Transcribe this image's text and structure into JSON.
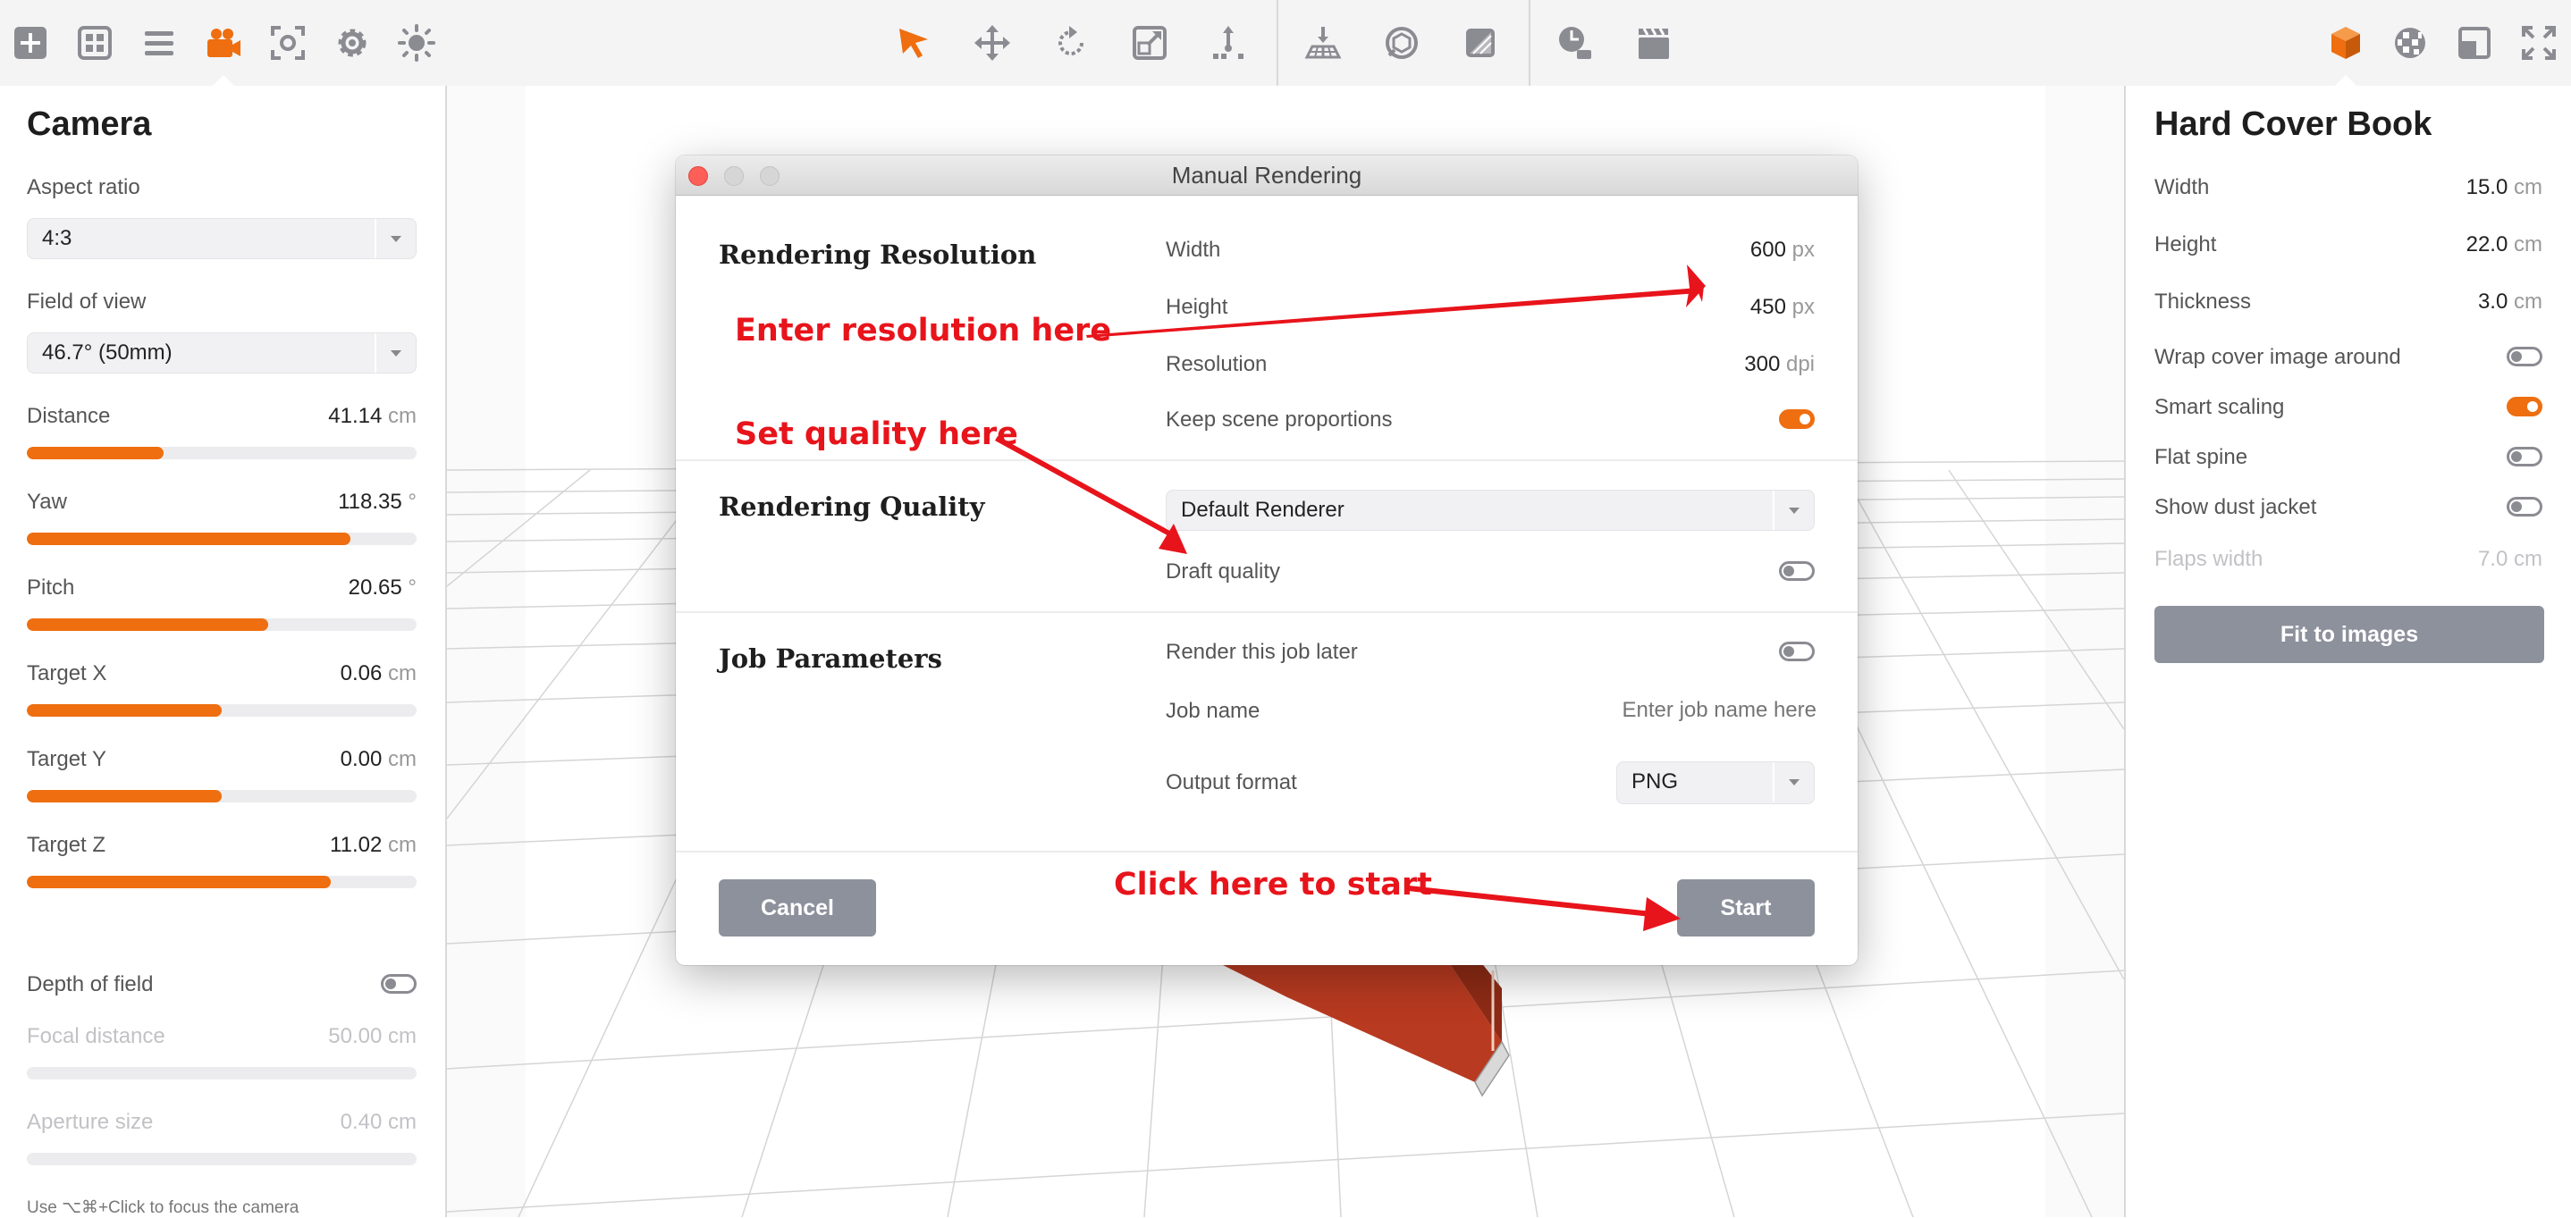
{
  "toolbar": {
    "left_icons": [
      "add-icon",
      "grid-icon",
      "list-icon",
      "camera-icon",
      "focus-icon",
      "gear-icon",
      "light-icon"
    ],
    "center_icons": [
      "select-arrow-icon",
      "move-icon",
      "rotate-icon",
      "scale-icon",
      "transform-icon"
    ],
    "scene_icons": [
      "ground-icon",
      "environment-icon",
      "material-icon"
    ],
    "render_icons": [
      "render-queue-icon",
      "clapper-icon"
    ],
    "right_icons": [
      "object-cube-icon",
      "texture-ball-icon",
      "layout-icon",
      "fullscreen-icon"
    ],
    "accent": "#ee6e10",
    "icon_color": "#8b8b92"
  },
  "camera": {
    "title": "Camera",
    "aspect_ratio_label": "Aspect ratio",
    "aspect_ratio_value": "4:3",
    "fov_label": "Field of view",
    "fov_value": "46.7° (50mm)",
    "sliders": [
      {
        "label": "Distance",
        "value": "41.14",
        "unit": "cm",
        "fraction": 0.35
      },
      {
        "label": "Yaw",
        "value": "118.35",
        "unit": "°",
        "fraction": 0.83
      },
      {
        "label": "Pitch",
        "value": "20.65",
        "unit": "°",
        "fraction": 0.62
      },
      {
        "label": "Target X",
        "value": "0.06",
        "unit": "cm",
        "fraction": 0.5
      },
      {
        "label": "Target Y",
        "value": "0.00",
        "unit": "cm",
        "fraction": 0.5
      },
      {
        "label": "Target Z",
        "value": "11.02",
        "unit": "cm",
        "fraction": 0.78
      }
    ],
    "dof_label": "Depth of field",
    "dof_on": false,
    "focal_label": "Focal distance",
    "focal_value": "50.00",
    "focal_unit": "cm",
    "aperture_label": "Aperture size",
    "aperture_value": "0.40",
    "aperture_unit": "cm",
    "hint": "Use ⌥⌘+Click to focus the camera"
  },
  "book": {
    "title": "Hard Cover Book",
    "width_label": "Width",
    "width_value": "15.0",
    "width_unit": "cm",
    "height_label": "Height",
    "height_value": "22.0",
    "height_unit": "cm",
    "thickness_label": "Thickness",
    "thickness_value": "3.0",
    "thickness_unit": "cm",
    "wrap_label": "Wrap cover image around",
    "wrap_on": false,
    "smart_label": "Smart scaling",
    "smart_on": true,
    "flat_label": "Flat spine",
    "flat_on": false,
    "dust_label": "Show dust jacket",
    "dust_on": false,
    "flaps_label": "Flaps width",
    "flaps_value": "7.0",
    "flaps_unit": "cm",
    "fit_button": "Fit to images"
  },
  "dialog": {
    "title": "Manual Rendering",
    "resolution_section": "Rendering Resolution",
    "width_label": "Width",
    "width_value": "600",
    "width_unit": "px",
    "height_label": "Height",
    "height_value": "450",
    "height_unit": "px",
    "resolution_label": "Resolution",
    "resolution_value": "300",
    "resolution_unit": "dpi",
    "keep_label": "Keep scene proportions",
    "keep_on": true,
    "quality_section": "Rendering Quality",
    "renderer_value": "Default Renderer",
    "draft_label": "Draft quality",
    "draft_on": false,
    "job_section": "Job Parameters",
    "later_label": "Render this job later",
    "later_on": false,
    "job_name_label": "Job name",
    "job_name_placeholder": "Enter job name here",
    "output_label": "Output format",
    "output_value": "PNG",
    "cancel_button": "Cancel",
    "start_button": "Start"
  },
  "annotations": {
    "resolution": "Enter resolution here",
    "quality": "Set quality here",
    "start": "Click here to start",
    "color": "#e8141b"
  }
}
